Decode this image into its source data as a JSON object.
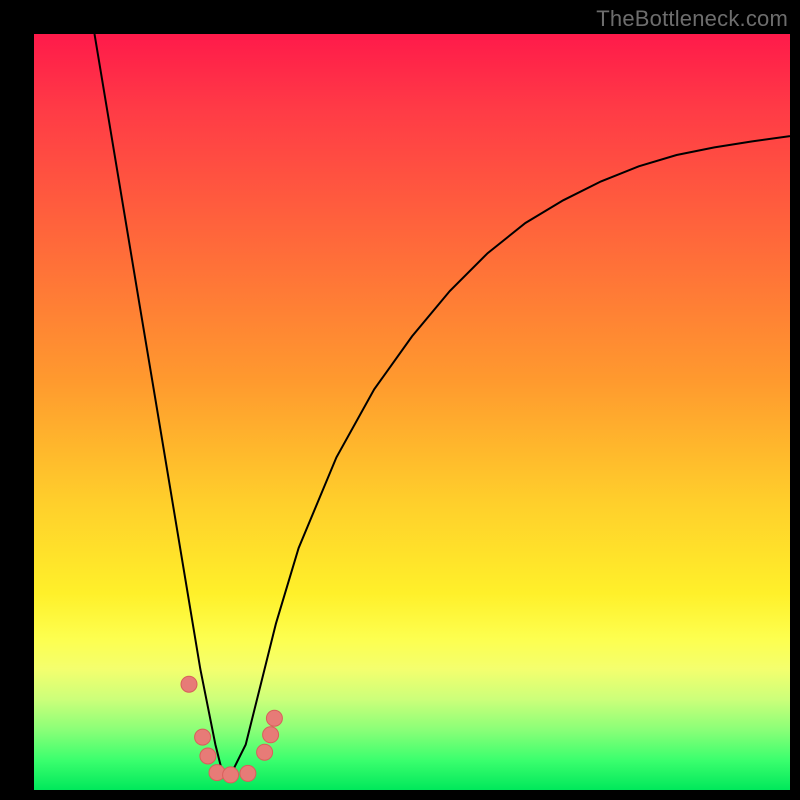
{
  "watermark": "TheBottleneck.com",
  "colors": {
    "frame": "#000000",
    "curve": "#000000",
    "marker_fill": "#e77b77",
    "marker_stroke": "#d85f5b"
  },
  "chart_data": {
    "type": "line",
    "title": "",
    "xlabel": "",
    "ylabel": "",
    "xlim": [
      0,
      100
    ],
    "ylim": [
      0,
      100
    ],
    "note": "Axes are unlabeled in the source image; x/y are normalized 0–100 left→right and bottom→top. The curve is a V-shaped bottleneck profile with its minimum near x≈25.",
    "series": [
      {
        "name": "bottleneck-curve",
        "x": [
          8,
          10,
          12,
          14,
          16,
          18,
          20,
          22,
          24,
          25,
          26,
          28,
          30,
          32,
          35,
          40,
          45,
          50,
          55,
          60,
          65,
          70,
          75,
          80,
          85,
          90,
          95,
          100
        ],
        "y": [
          100,
          88,
          76,
          64,
          52,
          40,
          28,
          16,
          6,
          2,
          2,
          6,
          14,
          22,
          32,
          44,
          53,
          60,
          66,
          71,
          75,
          78,
          80.5,
          82.5,
          84,
          85,
          85.8,
          86.5
        ]
      }
    ],
    "markers": {
      "name": "highlight-points",
      "note": "Salmon-colored dots clustered near the curve minimum.",
      "points": [
        {
          "x": 20.5,
          "y": 14
        },
        {
          "x": 22.3,
          "y": 7
        },
        {
          "x": 23.0,
          "y": 4.5
        },
        {
          "x": 24.2,
          "y": 2.3
        },
        {
          "x": 26.0,
          "y": 2.0
        },
        {
          "x": 28.3,
          "y": 2.2
        },
        {
          "x": 30.5,
          "y": 5.0
        },
        {
          "x": 31.3,
          "y": 7.3
        },
        {
          "x": 31.8,
          "y": 9.5
        }
      ]
    }
  }
}
